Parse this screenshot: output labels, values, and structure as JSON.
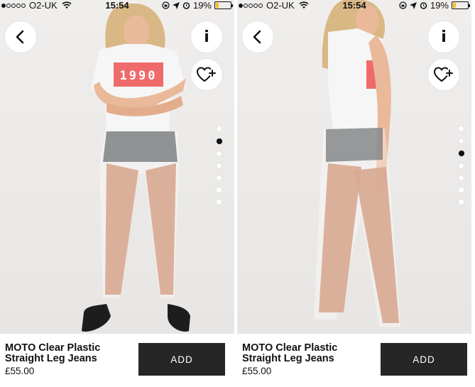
{
  "status_bar": {
    "carrier": "O2-UK",
    "time": "15:54",
    "battery": "19%",
    "battery_level": 0.19,
    "signal_bars_filled": 1,
    "signal_bars_total": 5,
    "icons": [
      "wifi-icon",
      "rotation-lock-icon",
      "location-arrow-icon",
      "alarm-icon",
      "battery-icon"
    ]
  },
  "screens": [
    {
      "buttons": {
        "back_icon": "chevron-left-icon",
        "info_label": "i",
        "wishlist_icon": "heart-plus-icon"
      },
      "pager": {
        "count": 7,
        "active_index": 1,
        "visible": "front view"
      },
      "tshirt_print": "1990",
      "product": {
        "name": "MOTO Clear Plastic Straight Leg Jeans",
        "price": "£55.00",
        "add_label": "ADD"
      }
    },
    {
      "buttons": {
        "back_icon": "chevron-left-icon",
        "info_label": "i",
        "wishlist_icon": "heart-plus-icon"
      },
      "pager": {
        "count": 7,
        "active_index": 2,
        "visible": "side view"
      },
      "tshirt_print": "",
      "product": {
        "name": "MOTO Clear Plastic Straight Leg Jeans",
        "price": "£55.00",
        "add_label": "ADD"
      }
    }
  ],
  "colors": {
    "add_button": "#262626",
    "battery": "#f2c21b",
    "print": "#ef6b6b",
    "background": "#eceae8"
  }
}
